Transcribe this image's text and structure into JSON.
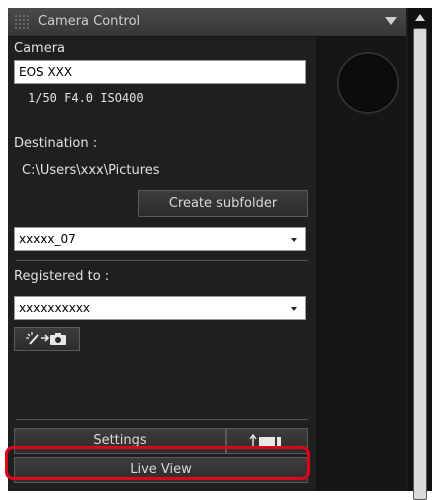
{
  "window": {
    "title": "Camera Control",
    "menu_icon": "triangle-down"
  },
  "camera": {
    "section_label": "Camera",
    "model": "EOS XXX",
    "settings_readout": "1/50  F4.0  ISO400"
  },
  "destination": {
    "label": "Destination :",
    "path": "C:\\Users\\xxx\\Pictures",
    "create_subfolder_label": "Create subfolder",
    "subfolder_value": "xxxxx_07"
  },
  "registered": {
    "label": "Registered to :",
    "value": "xxxxxxxxxx"
  },
  "buttons": {
    "settings_label": "Settings",
    "live_view_label": "Live View",
    "remote_shooting_icon": "wand-arrow-camera-icon",
    "sync_icon": "up-arrow-screen-icon"
  },
  "colors": {
    "panel_bg": "#1f1f1f",
    "highlight": "#e0001a"
  }
}
